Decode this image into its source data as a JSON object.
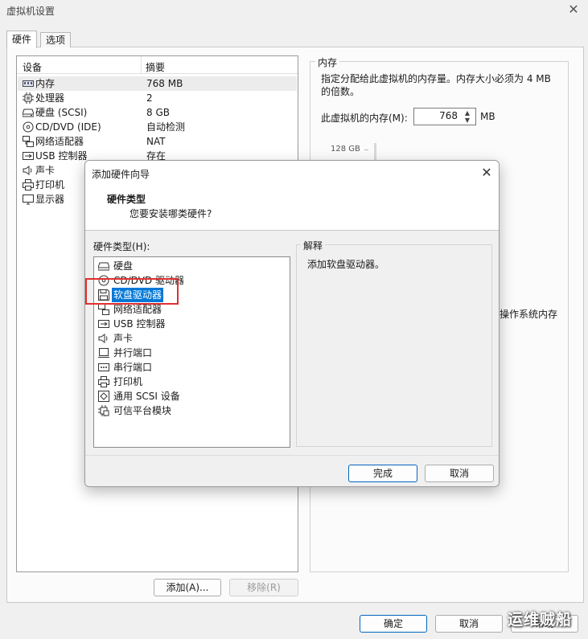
{
  "window": {
    "title": "虚拟机设置",
    "close_glyph": "✕"
  },
  "tabs": [
    {
      "label": "硬件"
    },
    {
      "label": "选项"
    }
  ],
  "device_table": {
    "headers": [
      "设备",
      "摘要"
    ],
    "rows": [
      {
        "name": "内存",
        "summary": "768 MB",
        "icon": "memory-icon"
      },
      {
        "name": "处理器",
        "summary": "2",
        "icon": "cpu-icon"
      },
      {
        "name": "硬盘 (SCSI)",
        "summary": "8 GB",
        "icon": "hard-disk-icon"
      },
      {
        "name": "CD/DVD (IDE)",
        "summary": "自动检测",
        "icon": "cd-dvd-icon"
      },
      {
        "name": "网络适配器",
        "summary": "NAT",
        "icon": "network-adapter-icon"
      },
      {
        "name": "USB 控制器",
        "summary": "存在",
        "icon": "usb-icon"
      },
      {
        "name": "声卡",
        "summary": "",
        "icon": "sound-card-icon"
      },
      {
        "name": "打印机",
        "summary": "",
        "icon": "printer-icon"
      },
      {
        "name": "显示器",
        "summary": "",
        "icon": "monitor-icon"
      }
    ]
  },
  "memory": {
    "legend": "内存",
    "description": "指定分配给此虚拟机的内存量。内存大小必须为 4 MB 的倍数。",
    "label": "此虚拟机的内存(M):",
    "value": "768",
    "unit": "MB",
    "slider_top_label": "128 GB",
    "os_fragment": "操作系统内存"
  },
  "buttons": {
    "add": "添加(A)...",
    "remove": "移除(R)",
    "ok": "确定",
    "cancel": "取消",
    "help": "帮助"
  },
  "wizard": {
    "title": "添加硬件向导",
    "close_glyph": "✕",
    "header_title": "硬件类型",
    "header_subtitle": "您要安装哪类硬件?",
    "list_label": "硬件类型(H):",
    "items": [
      {
        "name": "硬盘",
        "icon": "hard-disk-icon"
      },
      {
        "name": "CD/DVD 驱动器",
        "icon": "cd-dvd-icon"
      },
      {
        "name": "软盘驱动器",
        "icon": "floppy-icon"
      },
      {
        "name": "网络适配器",
        "icon": "network-adapter-icon"
      },
      {
        "name": "USB 控制器",
        "icon": "usb-icon"
      },
      {
        "name": "声卡",
        "icon": "sound-card-icon"
      },
      {
        "name": "并行端口",
        "icon": "parallel-port-icon"
      },
      {
        "name": "串行端口",
        "icon": "serial-port-icon"
      },
      {
        "name": "打印机",
        "icon": "printer-icon"
      },
      {
        "name": "通用 SCSI 设备",
        "icon": "scsi-icon"
      },
      {
        "name": "可信平台模块",
        "icon": "tpm-icon"
      }
    ],
    "selected_index": 2,
    "explain_legend": "解释",
    "explain_text": "添加软盘驱动器。",
    "finish": "完成",
    "cancel": "取消"
  },
  "watermark": "运维贼船"
}
